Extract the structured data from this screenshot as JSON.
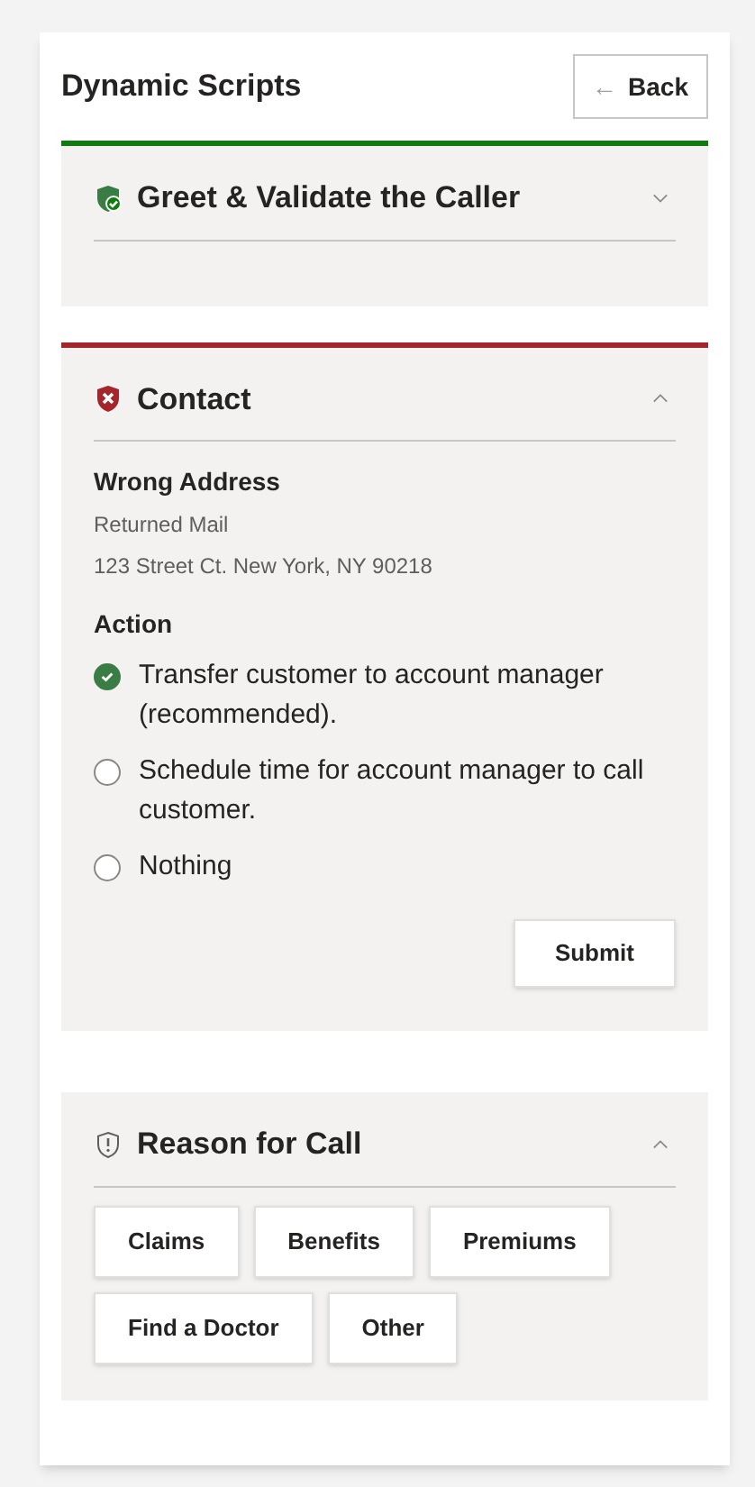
{
  "header": {
    "title": "Dynamic Scripts",
    "back_button": {
      "arrow": "←",
      "label": "Back"
    }
  },
  "sections": [
    {
      "title": "Greet & Validate the Caller",
      "complete": true,
      "error": false,
      "expanded": false
    },
    {
      "title": "Contact",
      "complete": false,
      "error": true,
      "expanded": true,
      "kind": "action_form",
      "issue": "Wrong Address",
      "detail": "Returned Mail",
      "address": "123 Street Ct. New York, NY 90218",
      "options_label": "Action",
      "options": [
        {
          "label": "Transfer customer to account manager (recommended).",
          "selected": true
        },
        {
          "label": "Schedule time for account manager to call customer.",
          "selected": false
        },
        {
          "label": "Nothing",
          "selected": false
        }
      ],
      "submit": "Submit"
    },
    {
      "title": "Reason for Call",
      "complete": false,
      "error": false,
      "expanded": true,
      "kind": "choices",
      "choices": [
        "Claims",
        "Benefits",
        "Premiums",
        "Find a Doctor",
        "Other"
      ]
    }
  ]
}
